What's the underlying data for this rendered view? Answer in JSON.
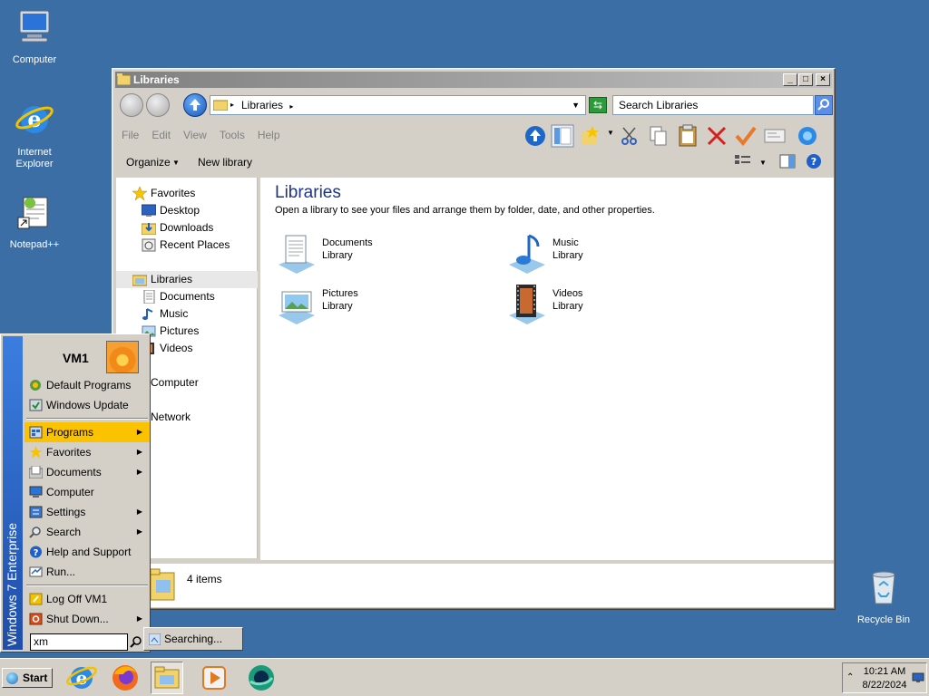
{
  "desktop": {
    "icons": [
      {
        "label": "Computer"
      },
      {
        "label": "Internet\nExplorer"
      },
      {
        "label": "Notepad++"
      },
      {
        "label": "Recycle Bin"
      }
    ]
  },
  "window": {
    "title": "Libraries",
    "address": "Libraries",
    "search_placeholder": "Search Libraries",
    "menu": [
      "File",
      "Edit",
      "View",
      "Tools",
      "Help"
    ],
    "commands": {
      "organize": "Organize",
      "new_library": "New library"
    },
    "nav": {
      "favorites": "Favorites",
      "desktop": "Desktop",
      "downloads": "Downloads",
      "recent": "Recent Places",
      "libraries": "Libraries",
      "documents": "Documents",
      "music": "Music",
      "pictures": "Pictures",
      "videos": "Videos",
      "computer": "Computer",
      "network": "Network"
    },
    "content": {
      "title": "Libraries",
      "subtitle": "Open a library to see your files and arrange them by folder, date, and other properties.",
      "libraries": [
        {
          "name": "Documents",
          "type": "Library"
        },
        {
          "name": "Music",
          "type": "Library"
        },
        {
          "name": "Pictures",
          "type": "Library"
        },
        {
          "name": "Videos",
          "type": "Library"
        }
      ]
    },
    "status": "4 items"
  },
  "start_menu": {
    "banner": "Windows 7 Enterprise",
    "user": "VM1",
    "items": {
      "default_programs": "Default Programs",
      "windows_update": "Windows Update",
      "programs": "Programs",
      "favorites": "Favorites",
      "documents": "Documents",
      "computer": "Computer",
      "settings": "Settings",
      "search": "Search",
      "help": "Help and Support",
      "run": "Run...",
      "logoff": "Log Off VM1",
      "shutdown": "Shut Down..."
    },
    "search_value": "xm",
    "popup": "Searching..."
  },
  "taskbar": {
    "start": "Start",
    "time": "10:21 AM",
    "date": "8/22/2024"
  }
}
